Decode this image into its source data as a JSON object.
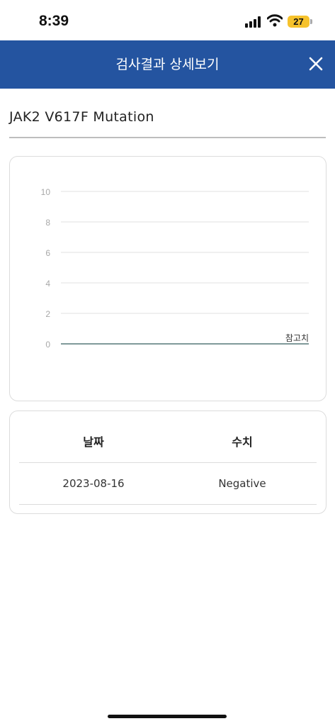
{
  "status_bar": {
    "time": "8:39",
    "battery": "27"
  },
  "header": {
    "title": "검사결과 상세보기"
  },
  "test": {
    "name": "JAK2 V617F Mutation"
  },
  "chart_data": {
    "type": "line",
    "y_ticks": [
      "10",
      "8",
      "6",
      "4",
      "2",
      "0"
    ],
    "ylim": [
      0,
      10
    ],
    "reference_label": "참고치",
    "reference_value": 0,
    "grid": true,
    "series": []
  },
  "table": {
    "columns": [
      "날짜",
      "수치"
    ],
    "rows": [
      {
        "date": "2023-08-16",
        "value": "Negative"
      }
    ]
  },
  "colors": {
    "header_bg": "#2454a0",
    "battery": "#f6c22c",
    "reference_line": "#7f9a9a"
  }
}
